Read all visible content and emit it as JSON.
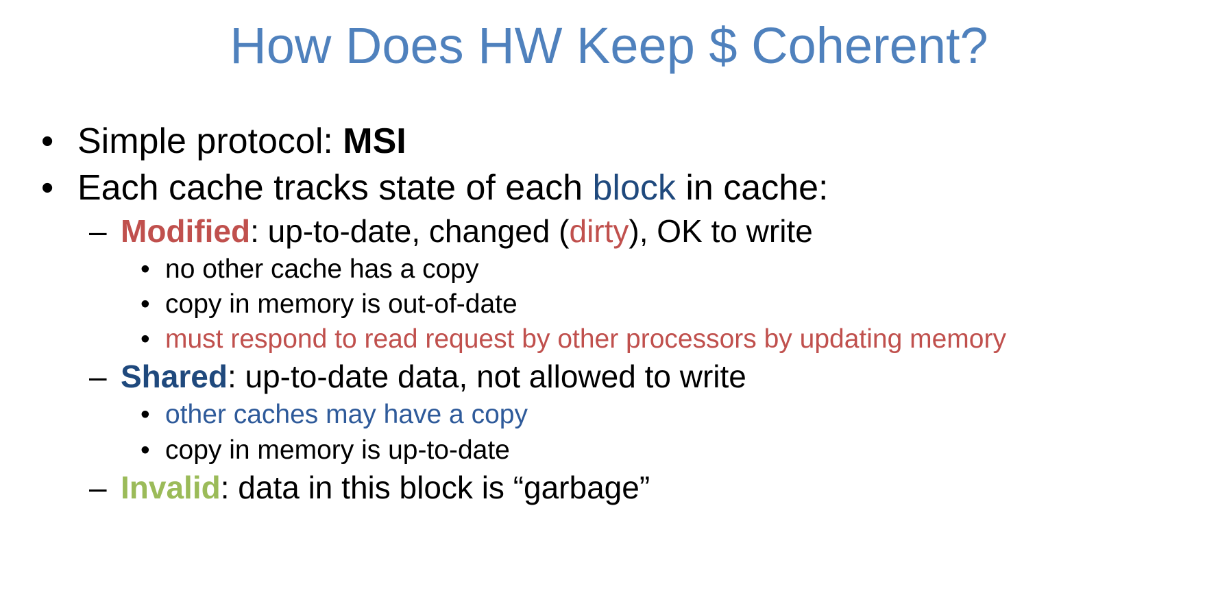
{
  "title": "How Does HW Keep $ Coherent?",
  "colors": {
    "title": "#4f81bd",
    "red": "#c0504d",
    "dark_blue": "#1f497d",
    "green": "#9bbb59"
  },
  "bullets": {
    "b1": {
      "marker": "•",
      "prefix": "Simple protocol: ",
      "bold": "MSI"
    },
    "b2": {
      "marker": "•",
      "prefix": "Each cache tracks state of each ",
      "highlight": "block",
      "suffix": " in cache:"
    },
    "modified": {
      "marker": "–",
      "state": "Modified",
      "desc_a": ": up-to-date, changed (",
      "dirty": "dirty",
      "desc_b": "), OK to write",
      "subs": [
        "no other cache has a copy",
        "copy in memory is out-of-date",
        "must respond to read request by other processors by updating memory"
      ]
    },
    "shared": {
      "marker": "–",
      "state": "Shared",
      "desc": ": up-to-date data, not allowed to write",
      "subs": [
        "other caches may have a copy",
        "copy in memory is up-to-date"
      ]
    },
    "invalid": {
      "marker": "–",
      "state": "Invalid",
      "desc": ": data in this block is “garbage”"
    },
    "sub_marker": "•"
  }
}
